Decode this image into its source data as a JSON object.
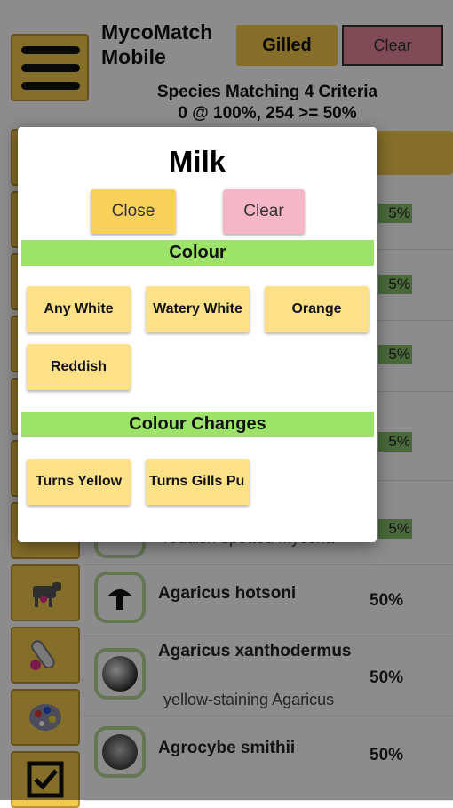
{
  "header": {
    "app_title": "MycoMatch\nMobile",
    "gilled_label": "Gilled",
    "clear_label": "Clear",
    "summary_line1": "Species Matching 4 Criteria",
    "summary_line2": "0 @ 100%, 254 >= 50%"
  },
  "list": {
    "partial_badges": [
      "5%",
      "5%",
      "5%",
      "5%",
      "5%"
    ],
    "partial_common_name": "reddish-spotted Mycena",
    "rows": [
      {
        "name": "Agaricus hotsoni",
        "common": "",
        "pct": "50%"
      },
      {
        "name": "Agaricus xanthodermus",
        "common": "yellow-staining Agaricus",
        "pct": "50%"
      },
      {
        "name": "Agrocybe smithii",
        "common": "",
        "pct": "50%"
      }
    ]
  },
  "sidebar": {
    "icons": [
      "cow-icon",
      "test-tube-icon",
      "palette-icon",
      "checkbox-icon"
    ]
  },
  "modal": {
    "title": "Milk",
    "close_label": "Close",
    "clear_label": "Clear",
    "sections": [
      {
        "title": "Colour",
        "options": [
          "Any White",
          "Watery White",
          "Orange",
          "Reddish"
        ]
      },
      {
        "title": "Colour Changes",
        "options": [
          "Turns Yellow",
          "Turns Gills Pu"
        ]
      }
    ]
  },
  "colors": {
    "accent_yellow": "#f2c94c",
    "section_green": "#9de36a",
    "clear_pink": "#f5b7c8",
    "option_yellow": "#fde189"
  }
}
